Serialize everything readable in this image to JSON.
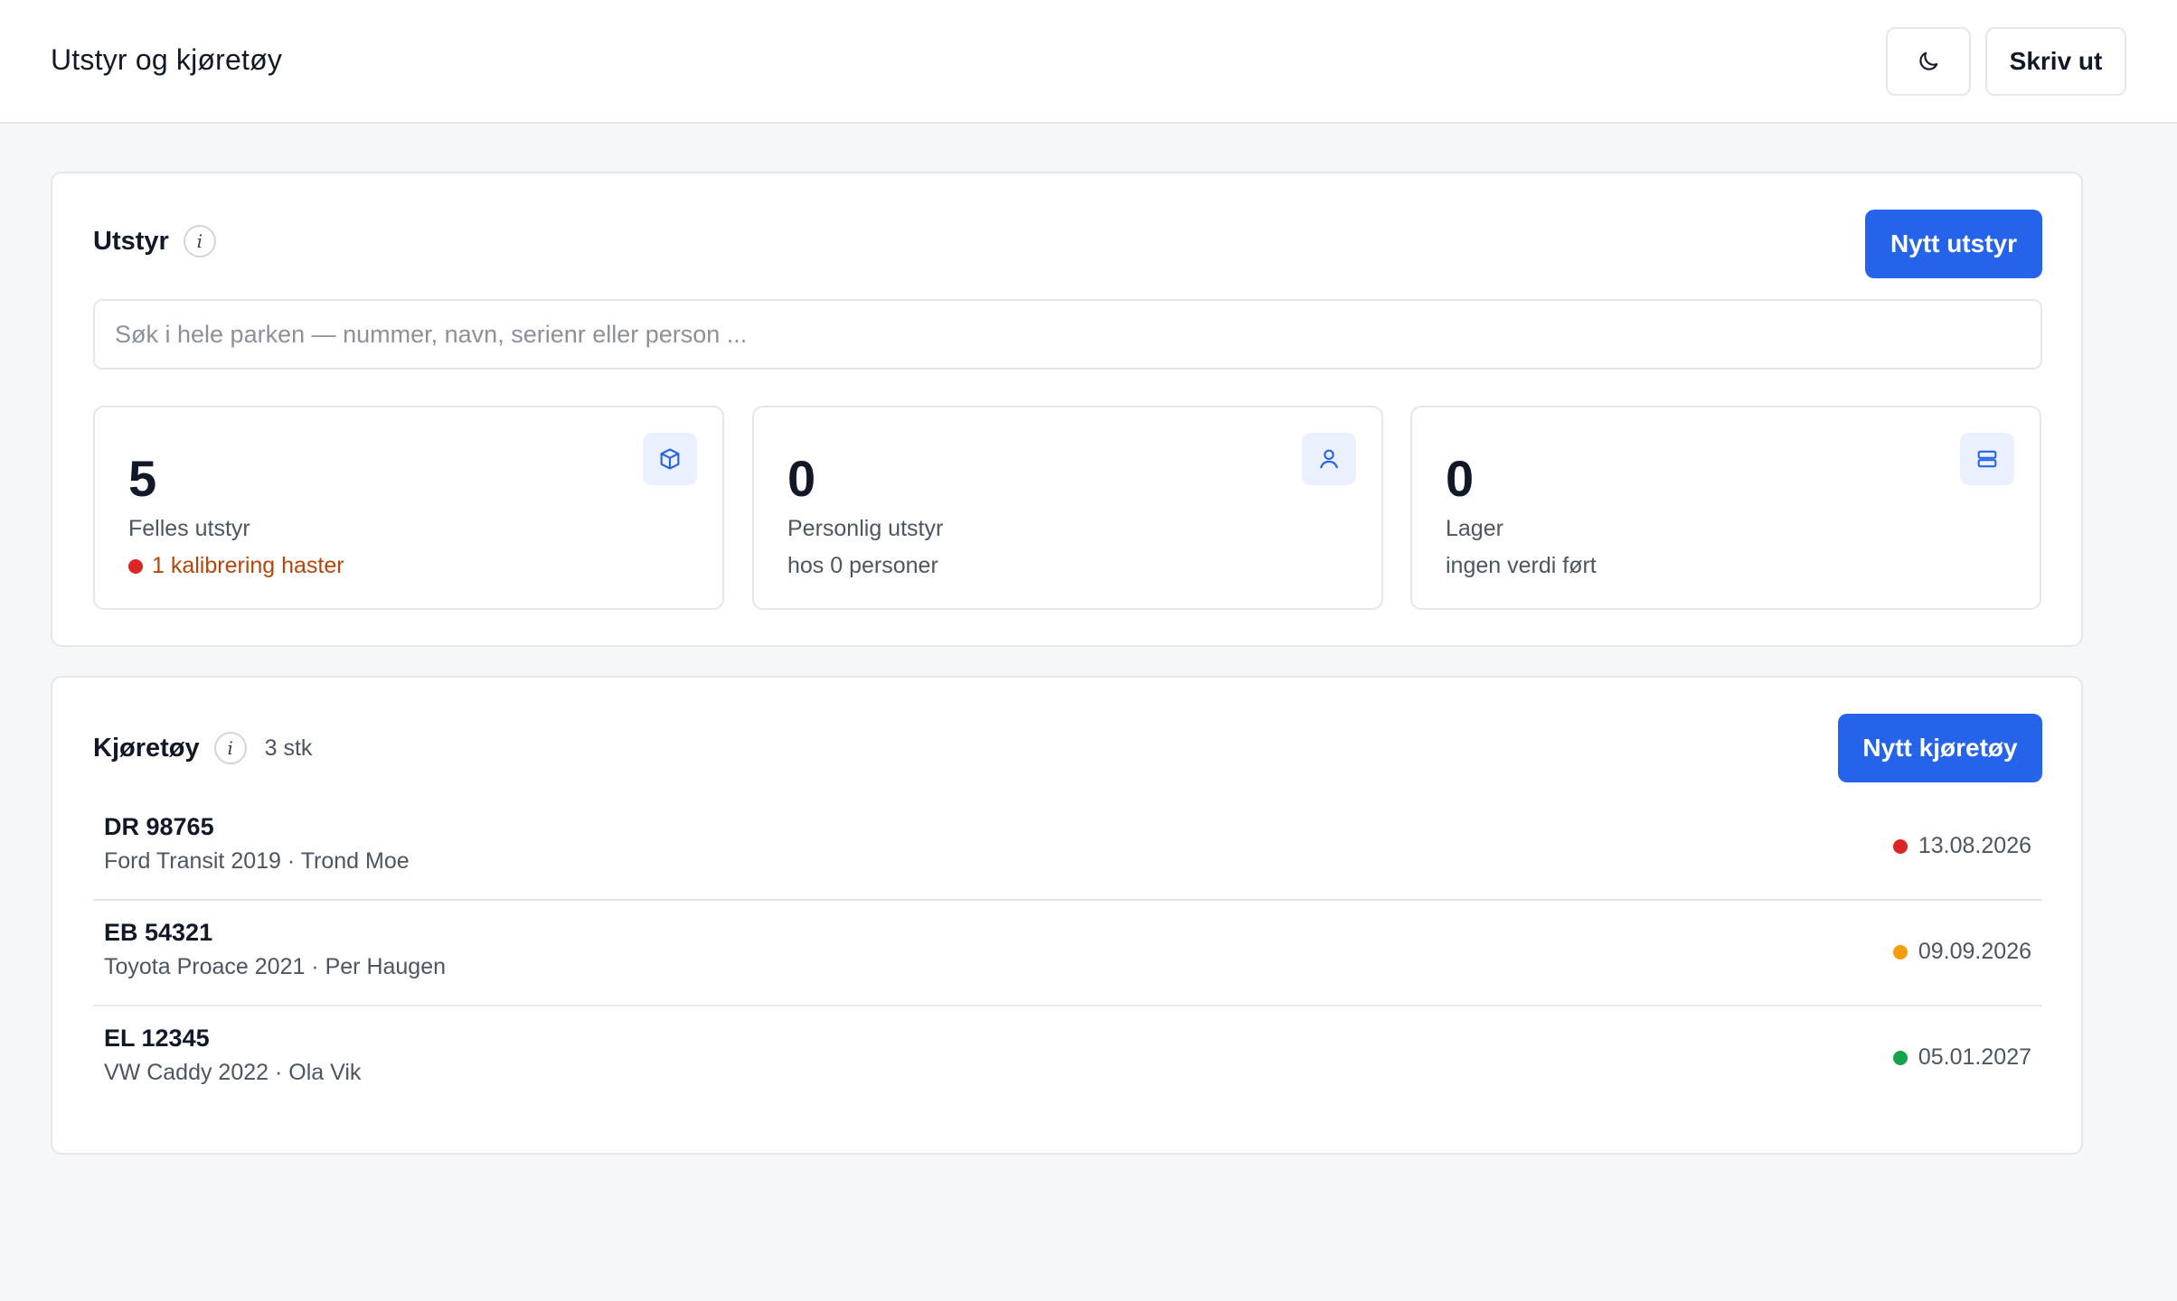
{
  "header": {
    "title": "Utstyr og kjøretøy",
    "theme_icon": "moon-icon",
    "print_label": "Skriv ut"
  },
  "equipment": {
    "title": "Utstyr",
    "info_icon": "info-icon",
    "new_button": "Nytt utstyr",
    "search_placeholder": "Søk i hele parken — nummer, navn, serienr eller person ...",
    "search_value": "",
    "stats": [
      {
        "value": "5",
        "label": "Felles utstyr",
        "sub": "1 kalibrering haster",
        "sub_status": "urgent",
        "icon": "box-icon"
      },
      {
        "value": "0",
        "label": "Personlig utstyr",
        "sub": "hos 0 personer",
        "icon": "person-icon"
      },
      {
        "value": "0",
        "label": "Lager",
        "sub": "ingen verdi ført",
        "icon": "storage-icon"
      }
    ]
  },
  "vehicles": {
    "title": "Kjøretøy",
    "info_icon": "info-icon",
    "count": "3 stk",
    "new_button": "Nytt kjøretøy",
    "items": [
      {
        "plate": "DR 98765",
        "description": "Ford Transit 2019 · Trond Moe",
        "date": "13.08.2026",
        "status": "red"
      },
      {
        "plate": "EB 54321",
        "description": "Toyota Proace 2021 · Per Haugen",
        "date": "09.09.2026",
        "status": "orange"
      },
      {
        "plate": "EL 12345",
        "description": "VW Caddy 2022 · Ola Vik",
        "date": "05.01.2027",
        "status": "green"
      }
    ]
  },
  "colors": {
    "primary": "#2563eb",
    "status_red": "#dc2626",
    "status_orange": "#f59e0b",
    "status_green": "#16a34a",
    "warning_text": "#b4460c"
  }
}
